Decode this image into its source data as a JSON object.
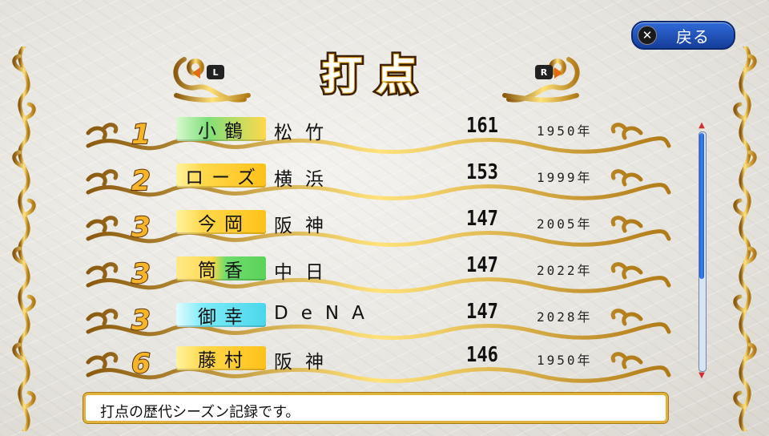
{
  "header": {
    "title": "打点",
    "left_shoulder": "L",
    "right_shoulder": "R",
    "back_button": {
      "key_glyph": "✕",
      "label": "戻る"
    }
  },
  "records": [
    {
      "rank": "1",
      "name": "小鶴",
      "team": "松竹",
      "value": "161",
      "year": "1950年",
      "tag_color": "green"
    },
    {
      "rank": "2",
      "name": "ローズ",
      "team": "横浜",
      "value": "153",
      "year": "1999年",
      "tag_color": "yellow"
    },
    {
      "rank": "3",
      "name": "今岡",
      "team": "阪神",
      "value": "147",
      "year": "2005年",
      "tag_color": "yellow"
    },
    {
      "rank": "3",
      "name": "筒香",
      "team": "中日",
      "value": "147",
      "year": "2022年",
      "tag_color": "green2"
    },
    {
      "rank": "3",
      "name": "御幸",
      "team": "DeNA",
      "value": "147",
      "year": "2028年",
      "tag_color": "cyan"
    },
    {
      "rank": "6",
      "name": "藤村",
      "team": "阪神",
      "value": "146",
      "year": "1950年",
      "tag_color": "yellow"
    }
  ],
  "scrollbar": {
    "position_fraction": 0.0,
    "visible_fraction": 0.62
  },
  "help_text": "打点の歴代シーズン記録です。",
  "colors": {
    "gold": "#e1b23a",
    "rank_fill": "#f5b52a",
    "back_button": "#2f6ad8",
    "scroll_thumb": "#1f5cd0"
  }
}
